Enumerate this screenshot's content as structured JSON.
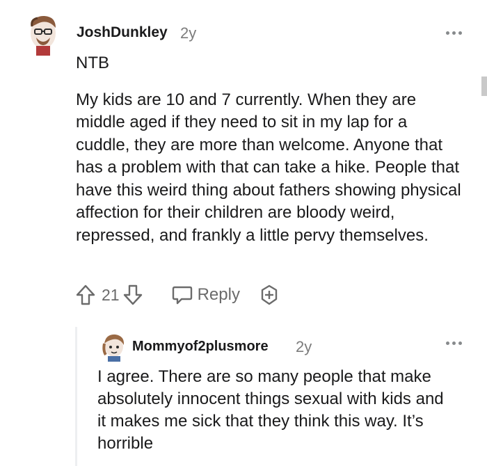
{
  "comment": {
    "username": "JoshDunkley",
    "time": "2y",
    "verdict": "NTB",
    "body": "My kids are 10 and 7 currently. When they are middle aged if they need to sit in my lap for a cuddle, they are more than welcome. Anyone that has a problem with that can take a hike. People that have this weird thing about fathers showing physical affection for their children are bloody weird, repressed, and frankly a little pervy themselves.",
    "vote_count": "21",
    "reply_label": "Reply"
  },
  "reply": {
    "username": "Mommyof2plusmore",
    "time": "2y",
    "body": "I agree. There are so many people that make absolutely innocent things sexual with kids and it makes me sick that they think this way. It’s horrible"
  },
  "colors": {
    "text": "#1a1a1b",
    "muted": "#7c7c7c",
    "icon": "#6b6b6b",
    "thread_line": "#edeff1"
  },
  "icons": [
    "upvote-icon",
    "downvote-icon",
    "reply-icon",
    "award-icon",
    "more-options-icon"
  ]
}
